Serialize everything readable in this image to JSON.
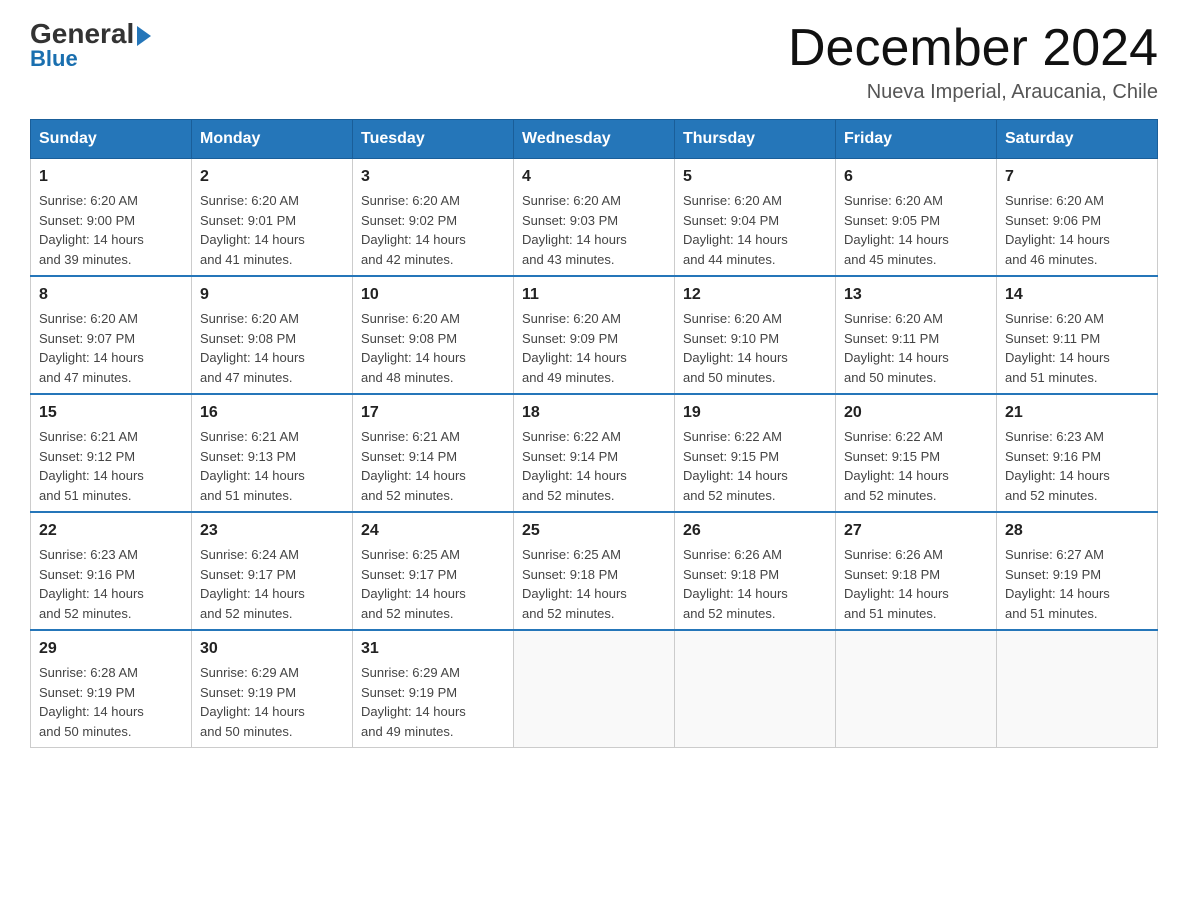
{
  "logo": {
    "general": "General",
    "arrow": "▶",
    "blue": "Blue"
  },
  "header": {
    "title": "December 2024",
    "location": "Nueva Imperial, Araucania, Chile"
  },
  "days_of_week": [
    "Sunday",
    "Monday",
    "Tuesday",
    "Wednesday",
    "Thursday",
    "Friday",
    "Saturday"
  ],
  "weeks": [
    [
      {
        "day": "1",
        "sunrise": "6:20 AM",
        "sunset": "9:00 PM",
        "daylight": "14 hours and 39 minutes."
      },
      {
        "day": "2",
        "sunrise": "6:20 AM",
        "sunset": "9:01 PM",
        "daylight": "14 hours and 41 minutes."
      },
      {
        "day": "3",
        "sunrise": "6:20 AM",
        "sunset": "9:02 PM",
        "daylight": "14 hours and 42 minutes."
      },
      {
        "day": "4",
        "sunrise": "6:20 AM",
        "sunset": "9:03 PM",
        "daylight": "14 hours and 43 minutes."
      },
      {
        "day": "5",
        "sunrise": "6:20 AM",
        "sunset": "9:04 PM",
        "daylight": "14 hours and 44 minutes."
      },
      {
        "day": "6",
        "sunrise": "6:20 AM",
        "sunset": "9:05 PM",
        "daylight": "14 hours and 45 minutes."
      },
      {
        "day": "7",
        "sunrise": "6:20 AM",
        "sunset": "9:06 PM",
        "daylight": "14 hours and 46 minutes."
      }
    ],
    [
      {
        "day": "8",
        "sunrise": "6:20 AM",
        "sunset": "9:07 PM",
        "daylight": "14 hours and 47 minutes."
      },
      {
        "day": "9",
        "sunrise": "6:20 AM",
        "sunset": "9:08 PM",
        "daylight": "14 hours and 47 minutes."
      },
      {
        "day": "10",
        "sunrise": "6:20 AM",
        "sunset": "9:08 PM",
        "daylight": "14 hours and 48 minutes."
      },
      {
        "day": "11",
        "sunrise": "6:20 AM",
        "sunset": "9:09 PM",
        "daylight": "14 hours and 49 minutes."
      },
      {
        "day": "12",
        "sunrise": "6:20 AM",
        "sunset": "9:10 PM",
        "daylight": "14 hours and 50 minutes."
      },
      {
        "day": "13",
        "sunrise": "6:20 AM",
        "sunset": "9:11 PM",
        "daylight": "14 hours and 50 minutes."
      },
      {
        "day": "14",
        "sunrise": "6:20 AM",
        "sunset": "9:11 PM",
        "daylight": "14 hours and 51 minutes."
      }
    ],
    [
      {
        "day": "15",
        "sunrise": "6:21 AM",
        "sunset": "9:12 PM",
        "daylight": "14 hours and 51 minutes."
      },
      {
        "day": "16",
        "sunrise": "6:21 AM",
        "sunset": "9:13 PM",
        "daylight": "14 hours and 51 minutes."
      },
      {
        "day": "17",
        "sunrise": "6:21 AM",
        "sunset": "9:14 PM",
        "daylight": "14 hours and 52 minutes."
      },
      {
        "day": "18",
        "sunrise": "6:22 AM",
        "sunset": "9:14 PM",
        "daylight": "14 hours and 52 minutes."
      },
      {
        "day": "19",
        "sunrise": "6:22 AM",
        "sunset": "9:15 PM",
        "daylight": "14 hours and 52 minutes."
      },
      {
        "day": "20",
        "sunrise": "6:22 AM",
        "sunset": "9:15 PM",
        "daylight": "14 hours and 52 minutes."
      },
      {
        "day": "21",
        "sunrise": "6:23 AM",
        "sunset": "9:16 PM",
        "daylight": "14 hours and 52 minutes."
      }
    ],
    [
      {
        "day": "22",
        "sunrise": "6:23 AM",
        "sunset": "9:16 PM",
        "daylight": "14 hours and 52 minutes."
      },
      {
        "day": "23",
        "sunrise": "6:24 AM",
        "sunset": "9:17 PM",
        "daylight": "14 hours and 52 minutes."
      },
      {
        "day": "24",
        "sunrise": "6:25 AM",
        "sunset": "9:17 PM",
        "daylight": "14 hours and 52 minutes."
      },
      {
        "day": "25",
        "sunrise": "6:25 AM",
        "sunset": "9:18 PM",
        "daylight": "14 hours and 52 minutes."
      },
      {
        "day": "26",
        "sunrise": "6:26 AM",
        "sunset": "9:18 PM",
        "daylight": "14 hours and 52 minutes."
      },
      {
        "day": "27",
        "sunrise": "6:26 AM",
        "sunset": "9:18 PM",
        "daylight": "14 hours and 51 minutes."
      },
      {
        "day": "28",
        "sunrise": "6:27 AM",
        "sunset": "9:19 PM",
        "daylight": "14 hours and 51 minutes."
      }
    ],
    [
      {
        "day": "29",
        "sunrise": "6:28 AM",
        "sunset": "9:19 PM",
        "daylight": "14 hours and 50 minutes."
      },
      {
        "day": "30",
        "sunrise": "6:29 AM",
        "sunset": "9:19 PM",
        "daylight": "14 hours and 50 minutes."
      },
      {
        "day": "31",
        "sunrise": "6:29 AM",
        "sunset": "9:19 PM",
        "daylight": "14 hours and 49 minutes."
      },
      null,
      null,
      null,
      null
    ]
  ],
  "labels": {
    "sunrise_prefix": "Sunrise: ",
    "sunset_prefix": "Sunset: ",
    "daylight_prefix": "Daylight: "
  }
}
